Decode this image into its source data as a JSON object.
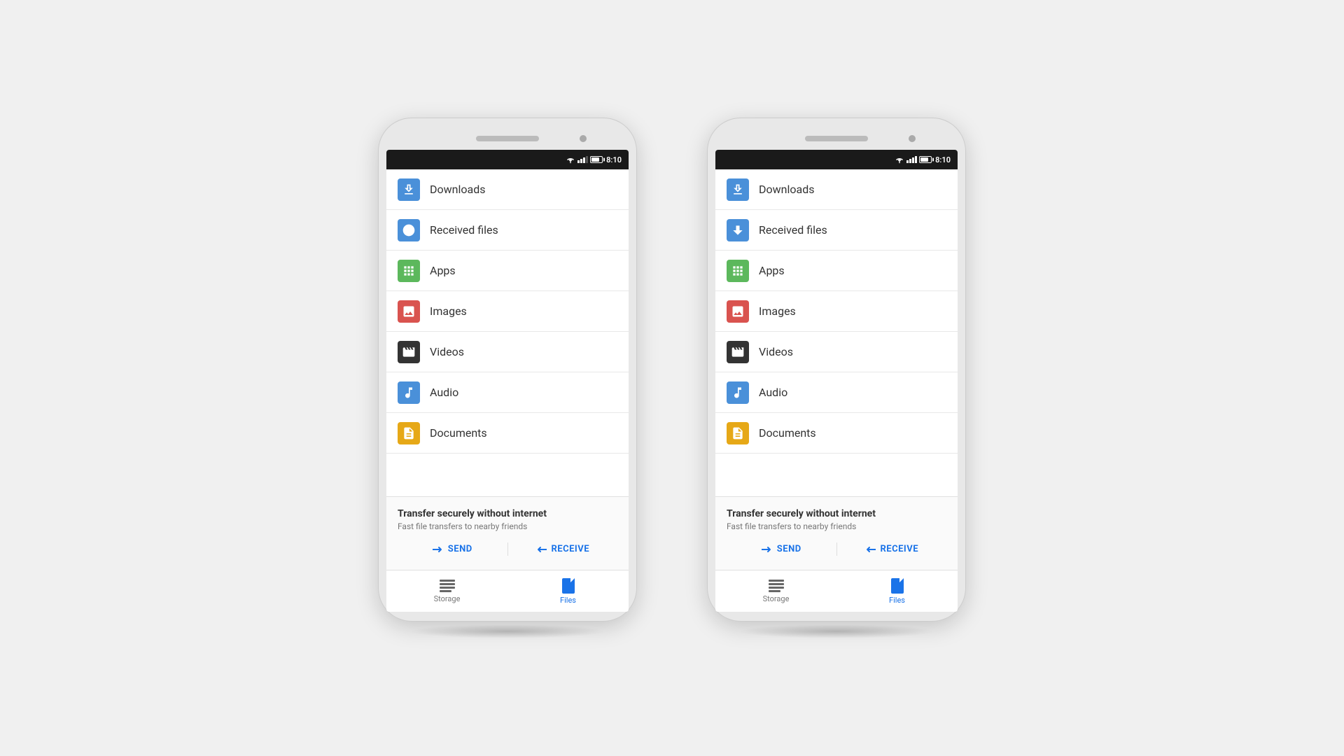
{
  "phone1": {
    "status_bar": {
      "time": "8:10"
    },
    "menu_items": [
      {
        "id": "downloads",
        "label": "Downloads",
        "icon_type": "downloads"
      },
      {
        "id": "received_files",
        "label": "Received files",
        "icon_type": "received"
      },
      {
        "id": "apps",
        "label": "Apps",
        "icon_type": "apps"
      },
      {
        "id": "images",
        "label": "Images",
        "icon_type": "images"
      },
      {
        "id": "videos",
        "label": "Videos",
        "icon_type": "videos"
      },
      {
        "id": "audio",
        "label": "Audio",
        "icon_type": "audio"
      },
      {
        "id": "documents",
        "label": "Documents",
        "icon_type": "documents"
      }
    ],
    "transfer": {
      "title": "Transfer securely without internet",
      "subtitle": "Fast file transfers to nearby friends",
      "send_label": "SEND",
      "receive_label": "RECEIVE"
    },
    "bottom_nav": {
      "storage_label": "Storage",
      "files_label": "Files"
    }
  },
  "phone2": {
    "status_bar": {
      "time": "8:10"
    },
    "menu_items": [
      {
        "id": "downloads",
        "label": "Downloads",
        "icon_type": "downloads"
      },
      {
        "id": "received_files",
        "label": "Received files",
        "icon_type": "received"
      },
      {
        "id": "apps",
        "label": "Apps",
        "icon_type": "apps"
      },
      {
        "id": "images",
        "label": "Images",
        "icon_type": "images"
      },
      {
        "id": "videos",
        "label": "Videos",
        "icon_type": "videos"
      },
      {
        "id": "audio",
        "label": "Audio",
        "icon_type": "audio"
      },
      {
        "id": "documents",
        "label": "Documents",
        "icon_type": "documents"
      }
    ],
    "transfer": {
      "title": "Transfer securely without internet",
      "subtitle": "Fast file transfers to nearby friends",
      "send_label": "SEND",
      "receive_label": "RECEIVE"
    },
    "bottom_nav": {
      "storage_label": "Storage",
      "files_label": "Files"
    }
  }
}
